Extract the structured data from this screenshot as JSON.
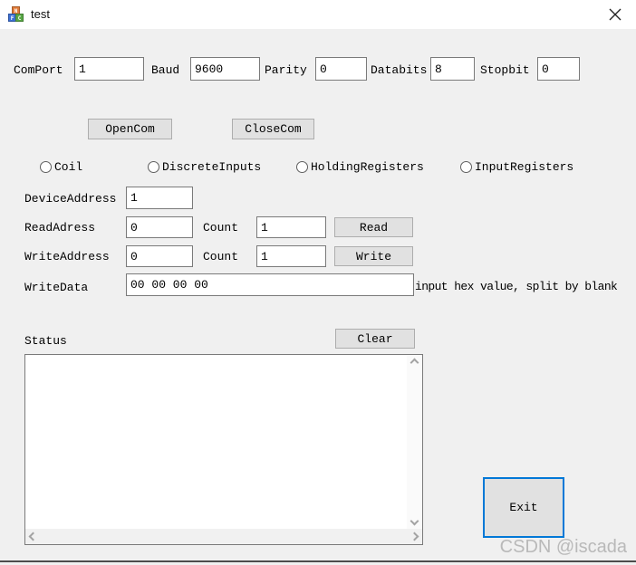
{
  "window": {
    "title": "test"
  },
  "serial": {
    "comport_label": "ComPort",
    "comport_value": "1",
    "baud_label": "Baud",
    "baud_value": "9600",
    "parity_label": "Parity",
    "parity_value": "0",
    "databits_label": "Databits",
    "databits_value": "8",
    "stopbit_label": "Stopbit",
    "stopbit_value": "0",
    "open_button": "OpenCom",
    "close_button": "CloseCom"
  },
  "register_types": {
    "coil": "Coil",
    "discrete_inputs": "DiscreteInputs",
    "holding_registers": "HoldingRegisters",
    "input_registers": "InputRegisters"
  },
  "modbus": {
    "device_address_label": "DeviceAddress",
    "device_address_value": "1",
    "read_address_label": "ReadAdress",
    "read_address_value": "0",
    "read_count_label": "Count",
    "read_count_value": "1",
    "read_button": "Read",
    "write_address_label": "WriteAddress",
    "write_address_value": "0",
    "write_count_label": "Count",
    "write_count_value": "1",
    "write_button": "Write",
    "write_data_label": "WriteData",
    "write_data_value": "00 00 00 00",
    "write_data_hint": "input hex value, split by blank"
  },
  "status": {
    "label": "Status",
    "clear_button": "Clear",
    "content": ""
  },
  "exit_button_label": "Exit",
  "watermark": "CSDN @iscada",
  "colors": {
    "accent_blue": "#0078d7",
    "button_face": "#e1e1e1",
    "form_background": "#f0f0f0",
    "textbox_border": "#7a7a7a"
  }
}
